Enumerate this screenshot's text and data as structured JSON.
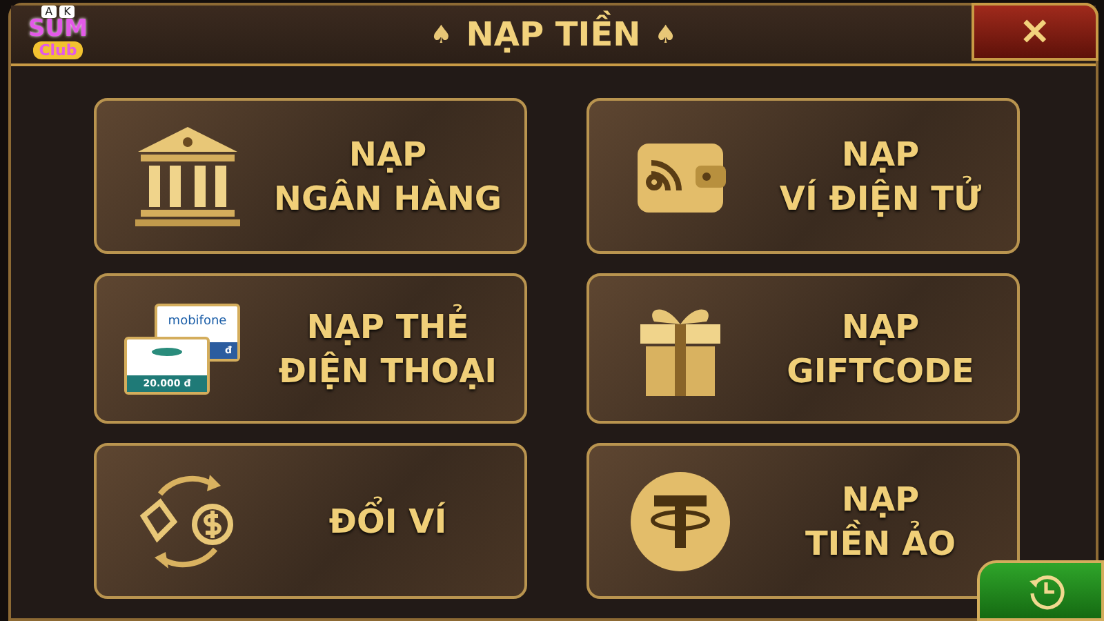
{
  "logo": {
    "cards": [
      "A",
      "K"
    ],
    "line1": "SUM",
    "line2": "Club"
  },
  "header": {
    "title": "NẠP TIỀN",
    "mark_left": "♠",
    "mark_right": "♠",
    "close": "✕"
  },
  "options": [
    {
      "kind": "bank",
      "lines": [
        "NẠP",
        "NGÂN HÀNG"
      ]
    },
    {
      "kind": "wallet",
      "lines": [
        "NẠP",
        "VÍ ĐIỆN TỬ"
      ]
    },
    {
      "kind": "phonecards",
      "lines": [
        "NẠP THẺ",
        "ĐIỆN THOẠI"
      ],
      "card_back": {
        "brand": "mobifone",
        "amount": "đ"
      },
      "card_front": {
        "amount": "20.000 đ"
      }
    },
    {
      "kind": "gift",
      "lines": [
        "NẠP",
        "GIFTCODE"
      ]
    },
    {
      "kind": "exchange",
      "lines": [
        "ĐỔI VÍ"
      ]
    },
    {
      "kind": "coin",
      "lines": [
        "NẠP",
        "TIỀN ẢO"
      ]
    }
  ]
}
